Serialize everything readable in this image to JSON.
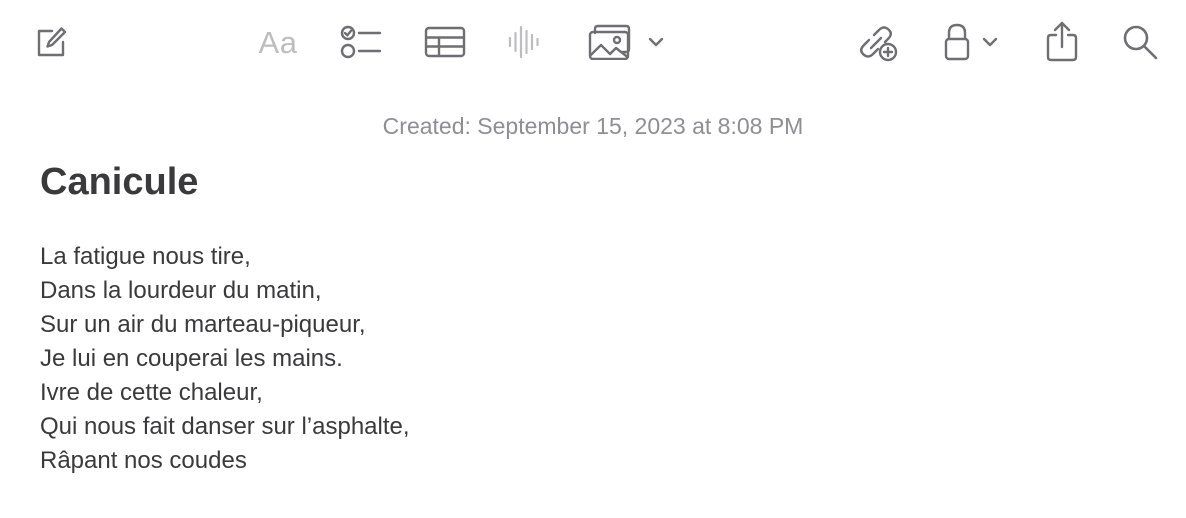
{
  "toolbar": {
    "compose": {
      "icon": "compose-icon"
    },
    "format": {
      "label": "Aa",
      "icon": "text-format-icon",
      "color": "#bdbdbf"
    },
    "checklist": {
      "icon": "checklist-icon"
    },
    "table": {
      "icon": "table-icon"
    },
    "audio": {
      "icon": "audio-waveform-icon",
      "color": "#bdbdbf"
    },
    "media": {
      "icon": "photo-gallery-icon",
      "dropdown_icon": "chevron-down-icon"
    },
    "collaborate": {
      "icon": "collaborate-link-icon"
    },
    "lock": {
      "icon": "lock-icon",
      "dropdown_icon": "chevron-down-icon"
    },
    "share": {
      "icon": "share-icon"
    },
    "search": {
      "icon": "search-icon"
    }
  },
  "note": {
    "created": "Created: September 15, 2023 at 8:08 PM",
    "title": "Canicule",
    "lines": [
      "La fatigue nous tire,",
      "Dans la lourdeur du matin,",
      "Sur un air du marteau-piqueur,",
      "Je lui en couperai les mains.",
      "Ivre de cette chaleur,",
      "Qui nous fait danser sur l’asphalte,",
      "Râpant nos coudes"
    ]
  },
  "colors": {
    "icon": "#6e6e73",
    "icon_disabled": "#bdbdbf",
    "text": "#3a3a3c",
    "meta_text": "#8e8e93",
    "background": "#ffffff"
  }
}
